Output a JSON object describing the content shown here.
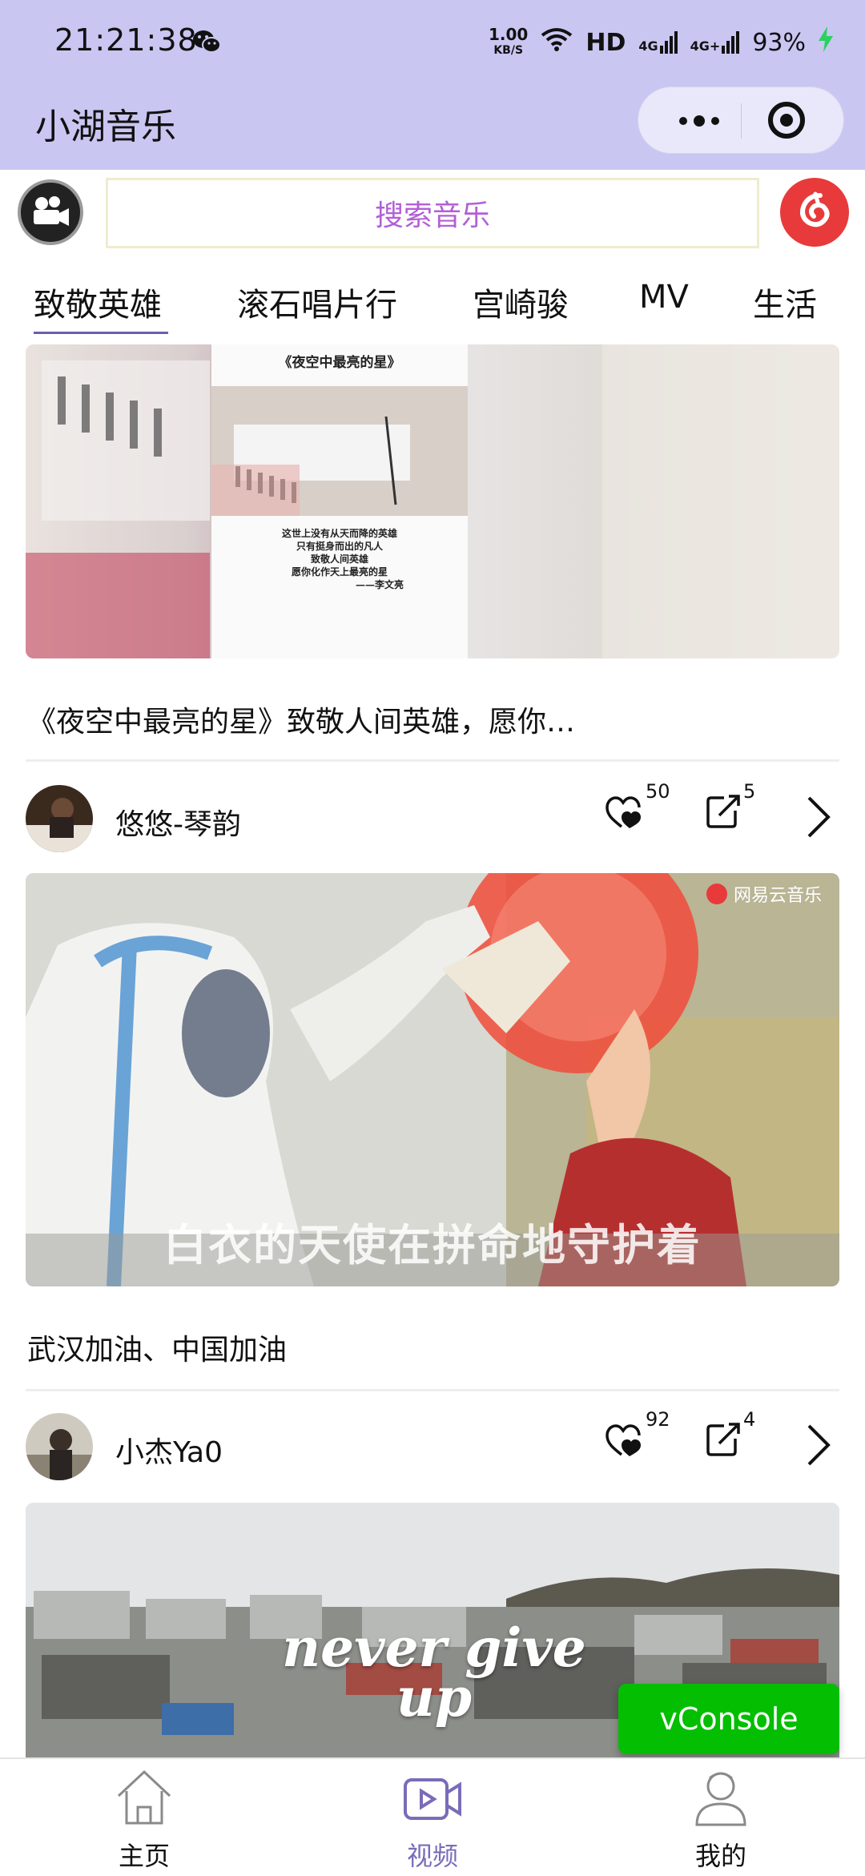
{
  "status_bar": {
    "time": "21:21:38",
    "net_speed_value": "1.00",
    "net_speed_unit": "KB/S",
    "hd_label": "HD",
    "signal1_label": "4G",
    "signal2_label": "4G+",
    "battery": "93%"
  },
  "title_bar": {
    "title": "小湖音乐"
  },
  "search": {
    "placeholder": "搜索音乐"
  },
  "tabs": [
    {
      "label": "致敬英雄",
      "active": true
    },
    {
      "label": "滚石唱片行",
      "active": false
    },
    {
      "label": "宫崎骏",
      "active": false
    },
    {
      "label": "MV",
      "active": false
    },
    {
      "label": "生活",
      "active": false
    }
  ],
  "videos": [
    {
      "overlay_title": "《夜空中最亮的星》",
      "overlay_lines": [
        "这世上没有从天而降的英雄",
        "只有挺身而出的凡人",
        "致敬人间英雄",
        "愿你化作天上最亮的星",
        "——李文亮"
      ],
      "description": "《夜空中最亮的星》致敬人间英雄，愿你…",
      "author": "悠悠-琴韵",
      "likes": "50",
      "comments": "5"
    },
    {
      "watermark": "网易云音乐",
      "subtitle": "白衣的天使在拼命地守护着",
      "description": "武汉加油、中国加油",
      "author": "小杰Ya0",
      "likes": "92",
      "comments": "4"
    },
    {
      "overlay_text": "never give up"
    }
  ],
  "vconsole": {
    "label": "vConsole"
  },
  "bottom_nav": [
    {
      "label": "主页",
      "active": false
    },
    {
      "label": "视频",
      "active": true
    },
    {
      "label": "我的",
      "active": false
    }
  ],
  "colors": {
    "header_bg": "#c9c6f2",
    "search_text": "#b25fd6",
    "active_tab_underline": "#6a5fb0",
    "active_nav": "#7a6cb8",
    "vconsole_bg": "#04be02",
    "netease_red": "#e83a3a"
  }
}
